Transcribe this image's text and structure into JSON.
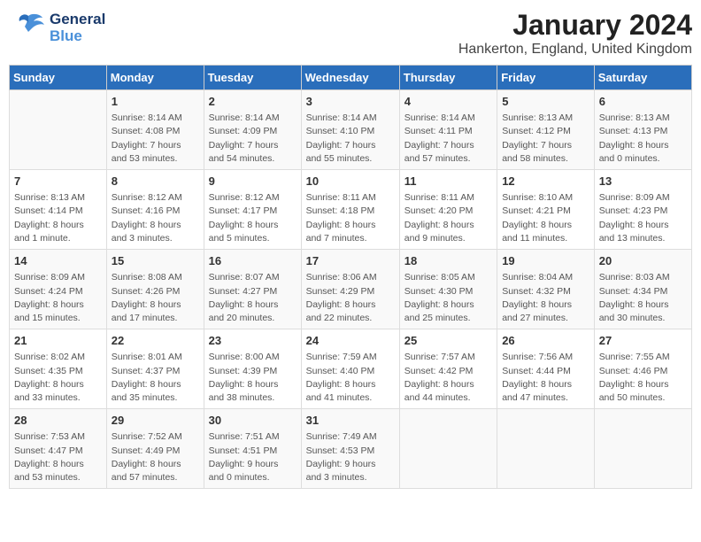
{
  "logo": {
    "line1": "General",
    "line2": "Blue"
  },
  "title": "January 2024",
  "subtitle": "Hankerton, England, United Kingdom",
  "days_of_week": [
    "Sunday",
    "Monday",
    "Tuesday",
    "Wednesday",
    "Thursday",
    "Friday",
    "Saturday"
  ],
  "weeks": [
    [
      {
        "day": "",
        "info": ""
      },
      {
        "day": "1",
        "info": "Sunrise: 8:14 AM\nSunset: 4:08 PM\nDaylight: 7 hours\nand 53 minutes."
      },
      {
        "day": "2",
        "info": "Sunrise: 8:14 AM\nSunset: 4:09 PM\nDaylight: 7 hours\nand 54 minutes."
      },
      {
        "day": "3",
        "info": "Sunrise: 8:14 AM\nSunset: 4:10 PM\nDaylight: 7 hours\nand 55 minutes."
      },
      {
        "day": "4",
        "info": "Sunrise: 8:14 AM\nSunset: 4:11 PM\nDaylight: 7 hours\nand 57 minutes."
      },
      {
        "day": "5",
        "info": "Sunrise: 8:13 AM\nSunset: 4:12 PM\nDaylight: 7 hours\nand 58 minutes."
      },
      {
        "day": "6",
        "info": "Sunrise: 8:13 AM\nSunset: 4:13 PM\nDaylight: 8 hours\nand 0 minutes."
      }
    ],
    [
      {
        "day": "7",
        "info": "Sunrise: 8:13 AM\nSunset: 4:14 PM\nDaylight: 8 hours\nand 1 minute."
      },
      {
        "day": "8",
        "info": "Sunrise: 8:12 AM\nSunset: 4:16 PM\nDaylight: 8 hours\nand 3 minutes."
      },
      {
        "day": "9",
        "info": "Sunrise: 8:12 AM\nSunset: 4:17 PM\nDaylight: 8 hours\nand 5 minutes."
      },
      {
        "day": "10",
        "info": "Sunrise: 8:11 AM\nSunset: 4:18 PM\nDaylight: 8 hours\nand 7 minutes."
      },
      {
        "day": "11",
        "info": "Sunrise: 8:11 AM\nSunset: 4:20 PM\nDaylight: 8 hours\nand 9 minutes."
      },
      {
        "day": "12",
        "info": "Sunrise: 8:10 AM\nSunset: 4:21 PM\nDaylight: 8 hours\nand 11 minutes."
      },
      {
        "day": "13",
        "info": "Sunrise: 8:09 AM\nSunset: 4:23 PM\nDaylight: 8 hours\nand 13 minutes."
      }
    ],
    [
      {
        "day": "14",
        "info": "Sunrise: 8:09 AM\nSunset: 4:24 PM\nDaylight: 8 hours\nand 15 minutes."
      },
      {
        "day": "15",
        "info": "Sunrise: 8:08 AM\nSunset: 4:26 PM\nDaylight: 8 hours\nand 17 minutes."
      },
      {
        "day": "16",
        "info": "Sunrise: 8:07 AM\nSunset: 4:27 PM\nDaylight: 8 hours\nand 20 minutes."
      },
      {
        "day": "17",
        "info": "Sunrise: 8:06 AM\nSunset: 4:29 PM\nDaylight: 8 hours\nand 22 minutes."
      },
      {
        "day": "18",
        "info": "Sunrise: 8:05 AM\nSunset: 4:30 PM\nDaylight: 8 hours\nand 25 minutes."
      },
      {
        "day": "19",
        "info": "Sunrise: 8:04 AM\nSunset: 4:32 PM\nDaylight: 8 hours\nand 27 minutes."
      },
      {
        "day": "20",
        "info": "Sunrise: 8:03 AM\nSunset: 4:34 PM\nDaylight: 8 hours\nand 30 minutes."
      }
    ],
    [
      {
        "day": "21",
        "info": "Sunrise: 8:02 AM\nSunset: 4:35 PM\nDaylight: 8 hours\nand 33 minutes."
      },
      {
        "day": "22",
        "info": "Sunrise: 8:01 AM\nSunset: 4:37 PM\nDaylight: 8 hours\nand 35 minutes."
      },
      {
        "day": "23",
        "info": "Sunrise: 8:00 AM\nSunset: 4:39 PM\nDaylight: 8 hours\nand 38 minutes."
      },
      {
        "day": "24",
        "info": "Sunrise: 7:59 AM\nSunset: 4:40 PM\nDaylight: 8 hours\nand 41 minutes."
      },
      {
        "day": "25",
        "info": "Sunrise: 7:57 AM\nSunset: 4:42 PM\nDaylight: 8 hours\nand 44 minutes."
      },
      {
        "day": "26",
        "info": "Sunrise: 7:56 AM\nSunset: 4:44 PM\nDaylight: 8 hours\nand 47 minutes."
      },
      {
        "day": "27",
        "info": "Sunrise: 7:55 AM\nSunset: 4:46 PM\nDaylight: 8 hours\nand 50 minutes."
      }
    ],
    [
      {
        "day": "28",
        "info": "Sunrise: 7:53 AM\nSunset: 4:47 PM\nDaylight: 8 hours\nand 53 minutes."
      },
      {
        "day": "29",
        "info": "Sunrise: 7:52 AM\nSunset: 4:49 PM\nDaylight: 8 hours\nand 57 minutes."
      },
      {
        "day": "30",
        "info": "Sunrise: 7:51 AM\nSunset: 4:51 PM\nDaylight: 9 hours\nand 0 minutes."
      },
      {
        "day": "31",
        "info": "Sunrise: 7:49 AM\nSunset: 4:53 PM\nDaylight: 9 hours\nand 3 minutes."
      },
      {
        "day": "",
        "info": ""
      },
      {
        "day": "",
        "info": ""
      },
      {
        "day": "",
        "info": ""
      }
    ]
  ]
}
